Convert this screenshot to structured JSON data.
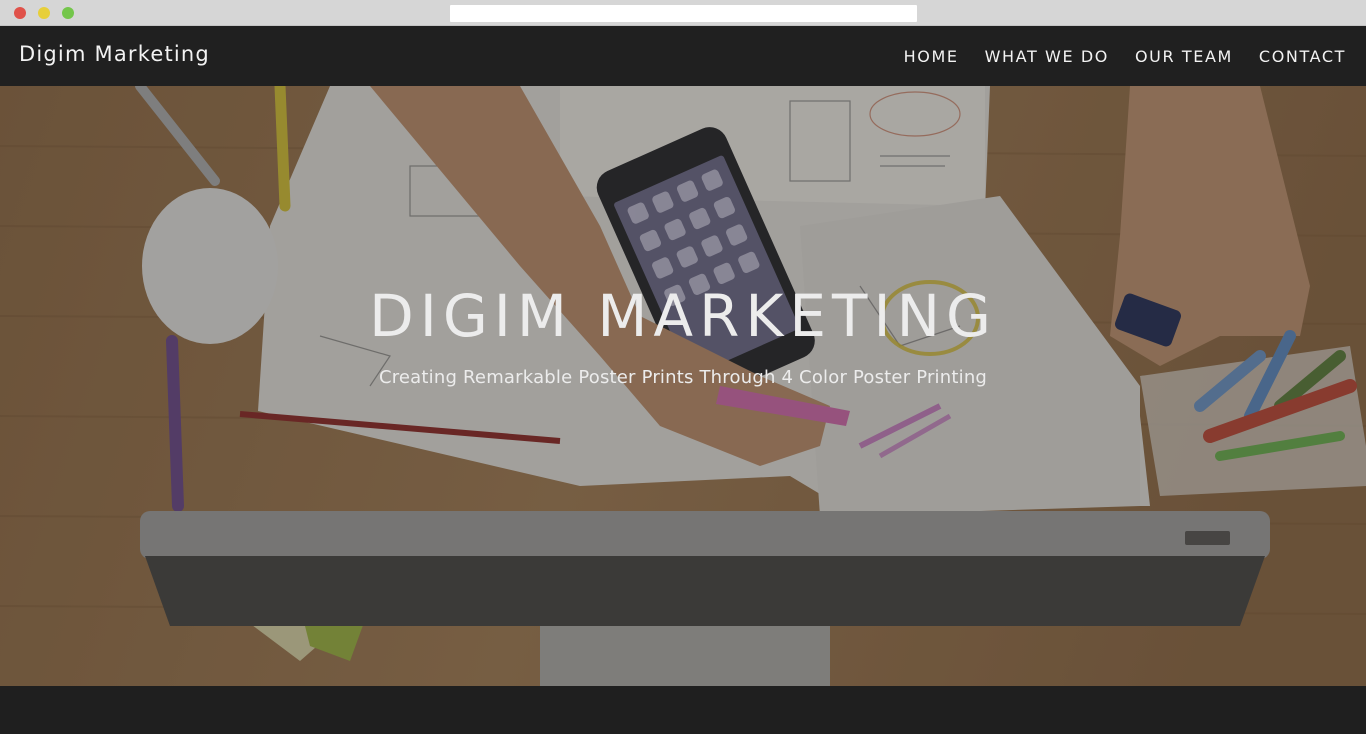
{
  "navbar": {
    "brand": "Digim Marketing",
    "items": [
      {
        "label": "HOME"
      },
      {
        "label": "WHAT WE DO"
      },
      {
        "label": "OUR TEAM"
      },
      {
        "label": "CONTACT"
      }
    ]
  },
  "hero": {
    "title": "DIGIM MARKETING",
    "subtitle": "Creating Remarkable Poster Prints Through 4 Color Poster Printing"
  },
  "colors": {
    "navbar_bg": "#202020",
    "nav_text": "#f2f2f2",
    "hero_text": "#ececec"
  }
}
